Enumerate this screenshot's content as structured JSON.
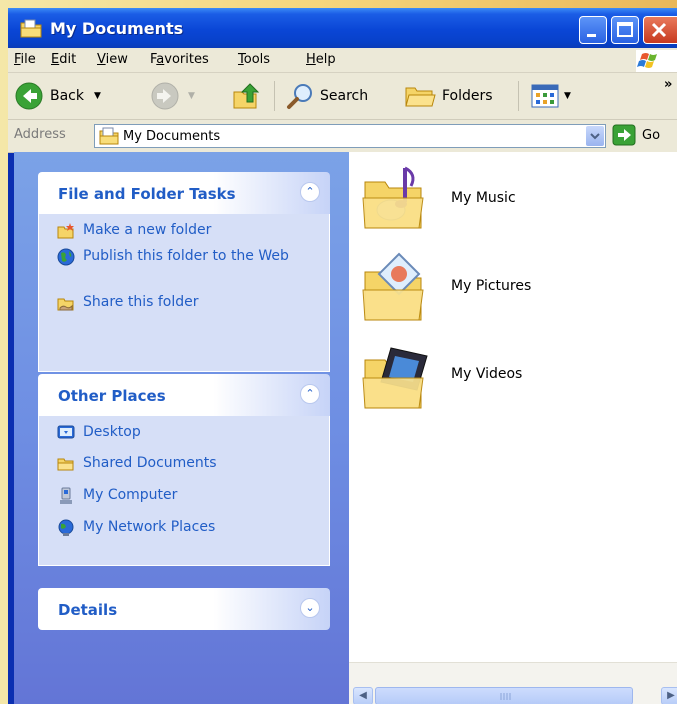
{
  "window": {
    "title": "My Documents"
  },
  "menu": {
    "items": [
      {
        "hot": "F",
        "rest": "ile"
      },
      {
        "hot": "E",
        "rest": "dit"
      },
      {
        "hot": "V",
        "rest": "iew"
      },
      {
        "pre": "F",
        "hot": "a",
        "rest": "vorites"
      },
      {
        "hot": "T",
        "rest": "ools"
      },
      {
        "hot": "H",
        "rest": "elp"
      }
    ]
  },
  "toolbar": {
    "back_label": "Back",
    "search_label": "Search",
    "folders_label": "Folders",
    "overflow_label": "»"
  },
  "address": {
    "label": "Address",
    "value": "My Documents",
    "go_label": "Go"
  },
  "tasks_panel": {
    "title": "File and Folder Tasks",
    "items": [
      {
        "label": "Make a new folder",
        "icon": "new-folder-icon"
      },
      {
        "label": "Publish this folder to the Web",
        "icon": "globe-icon"
      },
      {
        "label": "Share this folder",
        "icon": "share-folder-icon"
      }
    ]
  },
  "places_panel": {
    "title": "Other Places",
    "items": [
      {
        "label": "Desktop",
        "icon": "desktop-icon"
      },
      {
        "label": "Shared Documents",
        "icon": "folder-icon"
      },
      {
        "label": "My Computer",
        "icon": "computer-icon"
      },
      {
        "label": "My Network Places",
        "icon": "network-icon"
      }
    ]
  },
  "details_panel": {
    "title": "Details"
  },
  "files": [
    {
      "name": "My Music",
      "icon": "music-folder-icon"
    },
    {
      "name": "My Pictures",
      "icon": "pictures-folder-icon"
    },
    {
      "name": "My Videos",
      "icon": "videos-folder-icon"
    }
  ],
  "colors": {
    "title_bar": "#0a46d6",
    "task_link": "#215dc6",
    "task_pane": "#6e8ee3",
    "chrome": "#ece9d8"
  }
}
